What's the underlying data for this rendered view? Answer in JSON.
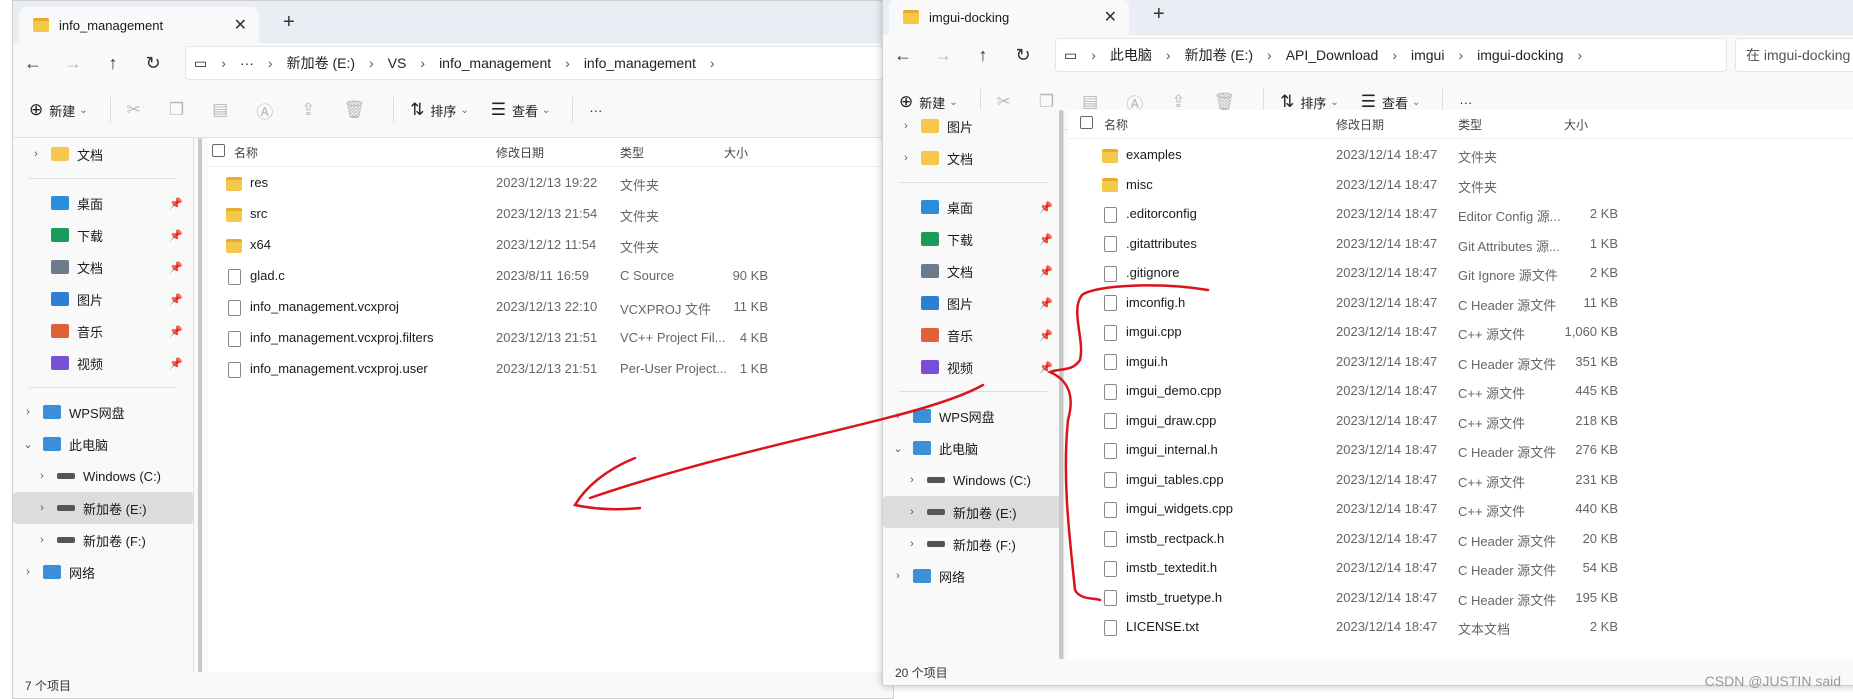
{
  "left_window": {
    "tab_title": "info_management",
    "breadcrumb": [
      "新加卷 (E:)",
      "VS",
      "info_management",
      "info_management"
    ],
    "toolbar": {
      "new": "新建",
      "sort": "排序",
      "view": "查看",
      "more": "···"
    },
    "sidebar_top": [
      {
        "label": "文档"
      }
    ],
    "sidebar_quick": [
      {
        "label": "桌面",
        "color": "#2a8fd8"
      },
      {
        "label": "下载",
        "color": "#1a9b5a"
      },
      {
        "label": "文档",
        "color": "#6b7b8c"
      },
      {
        "label": "图片",
        "color": "#2f7fd0"
      },
      {
        "label": "音乐",
        "color": "#e0603a"
      },
      {
        "label": "视频",
        "color": "#7a4fd8"
      }
    ],
    "sidebar_bottom": [
      {
        "label": "WPS网盘",
        "indent": 0,
        "chev": "›"
      },
      {
        "label": "此电脑",
        "indent": 0,
        "chev": "⌄"
      },
      {
        "label": "Windows (C:)",
        "indent": 1,
        "chev": "›"
      },
      {
        "label": "新加卷 (E:)",
        "indent": 1,
        "chev": "›",
        "selected": true
      },
      {
        "label": "新加卷 (F:)",
        "indent": 1,
        "chev": "›"
      },
      {
        "label": "网络",
        "indent": 0,
        "chev": "›"
      }
    ],
    "columns": [
      "名称",
      "修改日期",
      "类型",
      "大小"
    ],
    "files": [
      {
        "name": "res",
        "date": "2023/12/13 19:22",
        "type": "文件夹",
        "size": "",
        "kind": "folder"
      },
      {
        "name": "src",
        "date": "2023/12/13 21:54",
        "type": "文件夹",
        "size": "",
        "kind": "folder"
      },
      {
        "name": "x64",
        "date": "2023/12/12 11:54",
        "type": "文件夹",
        "size": "",
        "kind": "folder"
      },
      {
        "name": "glad.c",
        "date": "2023/8/11 16:59",
        "type": "C Source",
        "size": "90 KB",
        "kind": "file"
      },
      {
        "name": "info_management.vcxproj",
        "date": "2023/12/13 22:10",
        "type": "VCXPROJ 文件",
        "size": "11 KB",
        "kind": "file"
      },
      {
        "name": "info_management.vcxproj.filters",
        "date": "2023/12/13 21:51",
        "type": "VC++ Project Fil...",
        "size": "4 KB",
        "kind": "file"
      },
      {
        "name": "info_management.vcxproj.user",
        "date": "2023/12/13 21:51",
        "type": "Per-User Project...",
        "size": "1 KB",
        "kind": "file"
      }
    ],
    "status": "7 个项目"
  },
  "right_window": {
    "tab_title": "imgui-docking",
    "breadcrumb": [
      "此电脑",
      "新加卷 (E:)",
      "API_Download",
      "imgui",
      "imgui-docking"
    ],
    "search_placeholder": "在 imgui-docking",
    "toolbar": {
      "new": "新建",
      "sort": "排序",
      "view": "查看",
      "more": "···"
    },
    "sidebar_top": [
      {
        "label": "图片"
      },
      {
        "label": "文档"
      }
    ],
    "sidebar_quick": [
      {
        "label": "桌面",
        "color": "#2a8fd8"
      },
      {
        "label": "下载",
        "color": "#1a9b5a"
      },
      {
        "label": "文档",
        "color": "#6b7b8c"
      },
      {
        "label": "图片",
        "color": "#2f7fd0"
      },
      {
        "label": "音乐",
        "color": "#e0603a"
      },
      {
        "label": "视频",
        "color": "#7a4fd8"
      }
    ],
    "sidebar_bottom": [
      {
        "label": "WPS网盘",
        "indent": 0,
        "chev": "›"
      },
      {
        "label": "此电脑",
        "indent": 0,
        "chev": "⌄"
      },
      {
        "label": "Windows (C:)",
        "indent": 1,
        "chev": "›"
      },
      {
        "label": "新加卷 (E:)",
        "indent": 1,
        "chev": "›",
        "selected": true
      },
      {
        "label": "新加卷 (F:)",
        "indent": 1,
        "chev": "›"
      },
      {
        "label": "网络",
        "indent": 0,
        "chev": "›"
      }
    ],
    "columns": [
      "名称",
      "修改日期",
      "类型",
      "大小"
    ],
    "files": [
      {
        "name": "examples",
        "date": "2023/12/14 18:47",
        "type": "文件夹",
        "size": "",
        "kind": "folder"
      },
      {
        "name": "misc",
        "date": "2023/12/14 18:47",
        "type": "文件夹",
        "size": "",
        "kind": "folder"
      },
      {
        "name": ".editorconfig",
        "date": "2023/12/14 18:47",
        "type": "Editor Config 源...",
        "size": "2 KB",
        "kind": "file"
      },
      {
        "name": ".gitattributes",
        "date": "2023/12/14 18:47",
        "type": "Git Attributes 源...",
        "size": "1 KB",
        "kind": "file"
      },
      {
        "name": ".gitignore",
        "date": "2023/12/14 18:47",
        "type": "Git Ignore 源文件",
        "size": "2 KB",
        "kind": "file"
      },
      {
        "name": "imconfig.h",
        "date": "2023/12/14 18:47",
        "type": "C Header 源文件",
        "size": "11 KB",
        "kind": "file"
      },
      {
        "name": "imgui.cpp",
        "date": "2023/12/14 18:47",
        "type": "C++ 源文件",
        "size": "1,060 KB",
        "kind": "file"
      },
      {
        "name": "imgui.h",
        "date": "2023/12/14 18:47",
        "type": "C Header 源文件",
        "size": "351 KB",
        "kind": "file"
      },
      {
        "name": "imgui_demo.cpp",
        "date": "2023/12/14 18:47",
        "type": "C++ 源文件",
        "size": "445 KB",
        "kind": "file"
      },
      {
        "name": "imgui_draw.cpp",
        "date": "2023/12/14 18:47",
        "type": "C++ 源文件",
        "size": "218 KB",
        "kind": "file"
      },
      {
        "name": "imgui_internal.h",
        "date": "2023/12/14 18:47",
        "type": "C Header 源文件",
        "size": "276 KB",
        "kind": "file"
      },
      {
        "name": "imgui_tables.cpp",
        "date": "2023/12/14 18:47",
        "type": "C++ 源文件",
        "size": "231 KB",
        "kind": "file"
      },
      {
        "name": "imgui_widgets.cpp",
        "date": "2023/12/14 18:47",
        "type": "C++ 源文件",
        "size": "440 KB",
        "kind": "file"
      },
      {
        "name": "imstb_rectpack.h",
        "date": "2023/12/14 18:47",
        "type": "C Header 源文件",
        "size": "20 KB",
        "kind": "file"
      },
      {
        "name": "imstb_textedit.h",
        "date": "2023/12/14 18:47",
        "type": "C Header 源文件",
        "size": "54 KB",
        "kind": "file"
      },
      {
        "name": "imstb_truetype.h",
        "date": "2023/12/14 18:47",
        "type": "C Header 源文件",
        "size": "195 KB",
        "kind": "file"
      },
      {
        "name": "LICENSE.txt",
        "date": "2023/12/14 18:47",
        "type": "文本文档",
        "size": "2 KB",
        "kind": "file"
      }
    ],
    "status": "20 个项目"
  },
  "watermark": "CSDN @JUSTIN said",
  "annotation_color": "#d9141b"
}
